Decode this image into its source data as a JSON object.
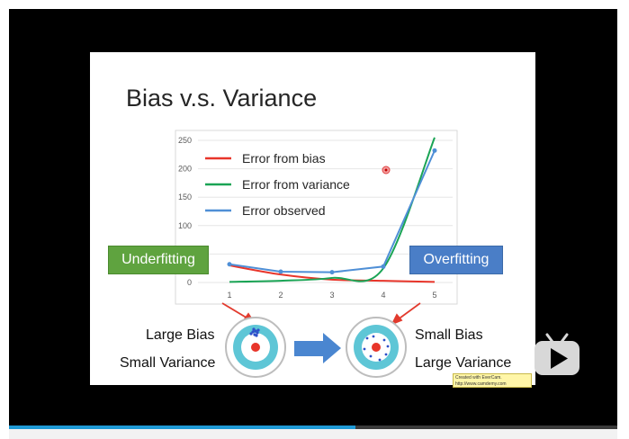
{
  "slide": {
    "title": "Bias v.s. Variance",
    "underfitting_label": "Underfitting",
    "overfitting_label": "Overfitting",
    "left_target": {
      "line1": "Large Bias",
      "line2": "Small Variance"
    },
    "right_target": {
      "line1": "Small Bias",
      "line2": "Large Variance"
    },
    "watermark_line1": "Created with EverCam.",
    "watermark_line2": "http://www.camdemy.com"
  },
  "player": {
    "progress": 0.57
  },
  "colors": {
    "bias": "#e8352a",
    "variance": "#1aa455",
    "observed": "#4f8fd6",
    "underfitting": "#5fa33f",
    "overfitting": "#4a7ec7",
    "progress": "#1f9ad6"
  },
  "icons": [
    "play-icon",
    "arrow-right-icon",
    "target-icon"
  ],
  "chart_data": {
    "type": "line",
    "x": [
      1,
      2,
      3,
      4,
      5
    ],
    "ylim": [
      0,
      250
    ],
    "yticks": [
      0,
      50,
      100,
      150,
      200,
      250
    ],
    "xticks": [
      1,
      2,
      3,
      4,
      5
    ],
    "legend_position": "top-left",
    "series": [
      {
        "name": "Error from bias",
        "values": [
          30,
          14,
          5,
          3,
          1
        ]
      },
      {
        "name": "Error from variance",
        "values": [
          1,
          3,
          8,
          25,
          255
        ]
      },
      {
        "name": "Error observed",
        "values": [
          32,
          19,
          18,
          28,
          232
        ]
      }
    ]
  }
}
